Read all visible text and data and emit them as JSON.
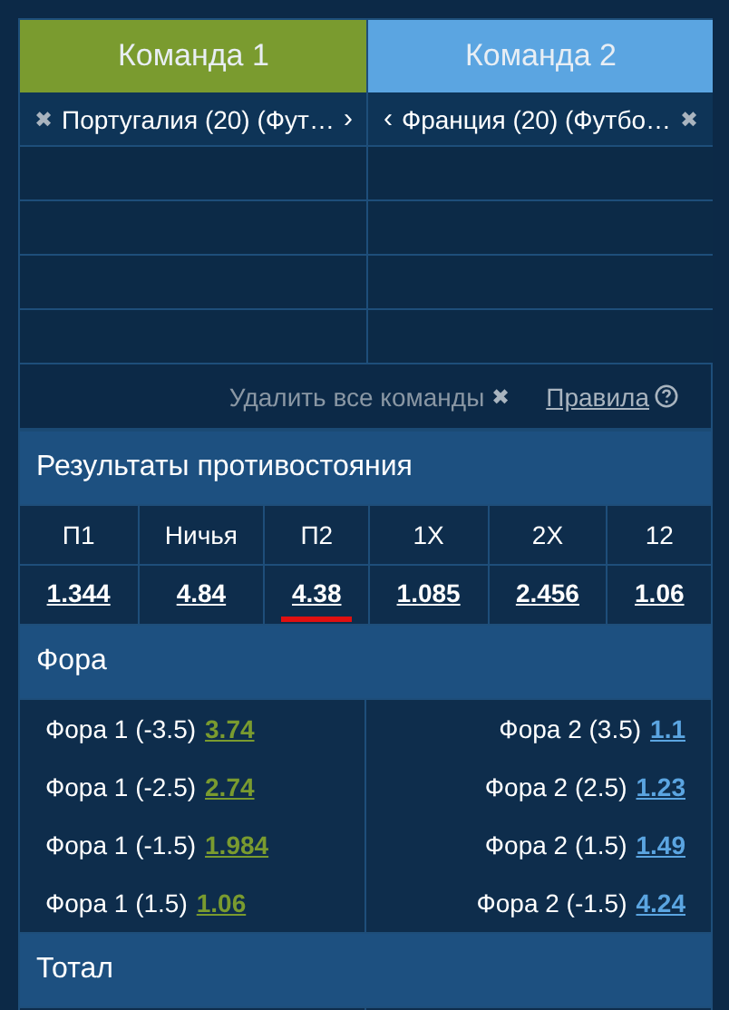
{
  "teams": [
    {
      "header": "Команда 1",
      "color": "#7a9b2f",
      "name": "Португалия (20) (Фут…",
      "remove": "✖",
      "arrow": "›"
    },
    {
      "header": "Команда 2",
      "color": "#5ba5e1",
      "name": "Франция (20) (Футбо…",
      "remove": "✖",
      "arrow": "‹"
    }
  ],
  "actions": {
    "remove_all": "Удалить все команды",
    "remove_icon": "✖",
    "rules": "Правила"
  },
  "results": {
    "title": "Результаты противостояния",
    "outcomes": [
      {
        "label": "П1",
        "odds": "1.344",
        "selected": false
      },
      {
        "label": "Ничья",
        "odds": "4.84",
        "selected": false
      },
      {
        "label": "П2",
        "odds": "4.38",
        "selected": true
      },
      {
        "label": "1X",
        "odds": "1.085",
        "selected": false
      },
      {
        "label": "2X",
        "odds": "2.456",
        "selected": false
      },
      {
        "label": "12",
        "odds": "1.06",
        "selected": false
      }
    ]
  },
  "handicap": {
    "title": "Фора",
    "rows": [
      {
        "left": {
          "label": "Фора 1 (-3.5)",
          "odds": "3.74"
        },
        "right": {
          "label": "Фора 2 (3.5)",
          "odds": "1.1"
        }
      },
      {
        "left": {
          "label": "Фора 1 (-2.5)",
          "odds": "2.74"
        },
        "right": {
          "label": "Фора 2 (2.5)",
          "odds": "1.23"
        }
      },
      {
        "left": {
          "label": "Фора 1 (-1.5)",
          "odds": "1.984"
        },
        "right": {
          "label": "Фора 2 (1.5)",
          "odds": "1.49"
        }
      },
      {
        "left": {
          "label": "Фора 1 (1.5)",
          "odds": "1.06"
        },
        "right": {
          "label": "Фора 2 (-1.5)",
          "odds": "4.24"
        }
      }
    ]
  },
  "total": {
    "title": "Тотал"
  }
}
